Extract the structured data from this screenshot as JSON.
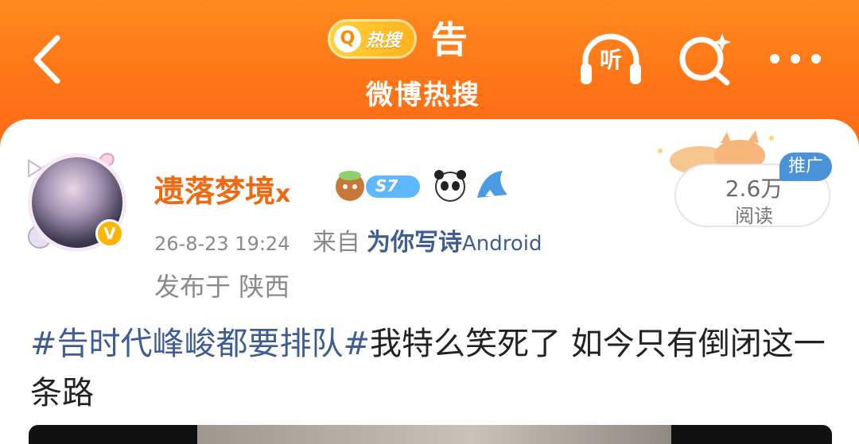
{
  "header": {
    "hot_badge_text": "热搜",
    "title_char": "告",
    "subtitle": "微博热搜",
    "listen_label": "听",
    "icons": [
      "back-icon",
      "headphones-icon",
      "search-icon",
      "more-icon"
    ]
  },
  "post": {
    "username": "遗落梦境",
    "username_suffix": "x",
    "level_badge": "S7",
    "timestamp": "26-8-23 19:24",
    "from_label": "来自",
    "source_app": "为你写诗",
    "source_os": "Android",
    "location": "发布于 陕西",
    "reads_count": "2.6万",
    "reads_label": "阅读",
    "promo_label": "推广",
    "topic": "#告时代峰峻都要排队#",
    "body": "我特么笑死了 如今只有倒闭这一条路",
    "verified_badge": "V"
  },
  "colors": {
    "header_orange": "#ff7a1a",
    "username": "#ee6a12",
    "link_blue": "#3d5d93",
    "promo_blue": "#4a93d9"
  }
}
